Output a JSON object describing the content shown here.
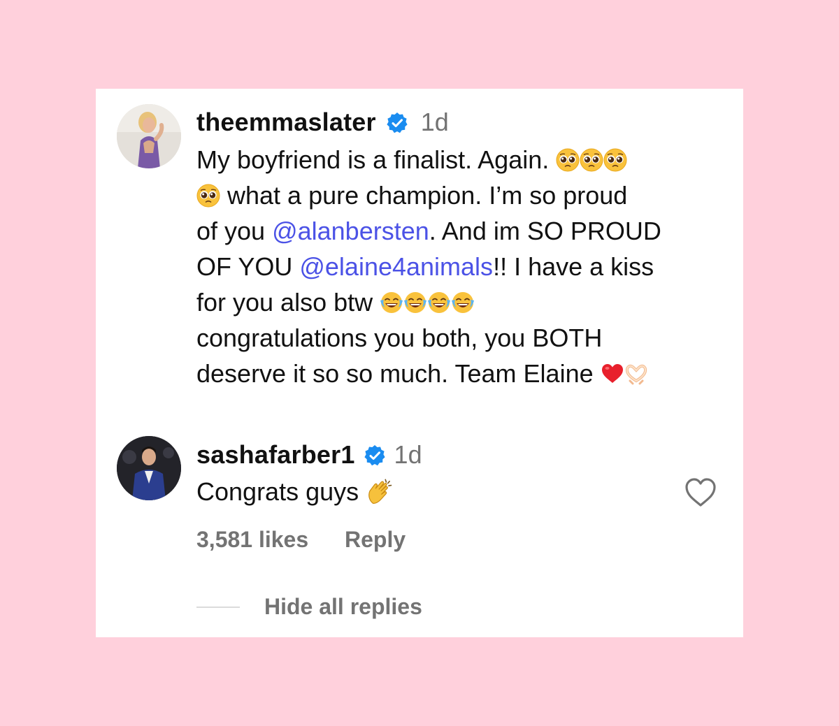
{
  "comment": {
    "username": "theemmaslater",
    "time": "1d",
    "lines": [
      {
        "t1": "My boyfriend is a finalist. Again. "
      },
      {
        "t2": " what a pure champion. I’m so proud"
      },
      {
        "t3a": "of you ",
        "m1": "@alanbersten",
        "t3b": ". And im SO PROUD"
      },
      {
        "t4a": "OF YOU ",
        "m2": "@elaine4animals",
        "t4b": "!! I have a kiss"
      },
      {
        "t5": "for you also btw "
      },
      {
        "t6": "congratulations you both, you BOTH"
      },
      {
        "t7": "deserve it so so much. Team Elaine "
      }
    ]
  },
  "reply": {
    "username": "sashafarber1",
    "time": "1d",
    "text": "Congrats guys ",
    "likes": "3,581 likes",
    "reply_label": "Reply"
  },
  "hide_replies_label": "Hide all replies",
  "icons": {
    "verified": "verified-badge-icon",
    "like": "heart-outline-icon",
    "emojis": [
      "pleading-face-emoji",
      "tears-of-joy-emoji",
      "red-heart-emoji",
      "heart-hands-emoji",
      "clapping-hands-emoji"
    ]
  },
  "colors": {
    "background": "#ffd0dc",
    "mention": "#4b52e6",
    "verified": "#1a8cf0",
    "muted": "#737373"
  }
}
